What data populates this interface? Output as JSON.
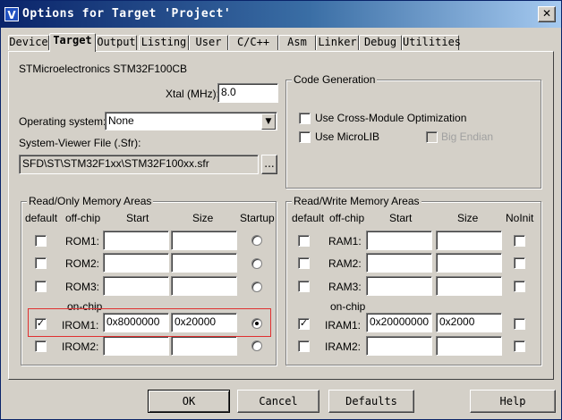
{
  "window": {
    "title": "Options for Target 'Project'",
    "close_glyph": "✕",
    "app_icon": "V"
  },
  "tabs": [
    "Device",
    "Target",
    "Output",
    "Listing",
    "User",
    "C/C++",
    "Asm",
    "Linker",
    "Debug",
    "Utilities"
  ],
  "active_tab": "Target",
  "device_name": "STMicroelectronics STM32F100CB",
  "xtal": {
    "label": "Xtal (MHz):",
    "value": "8.0"
  },
  "os": {
    "label": "Operating system:",
    "value": "None"
  },
  "sfr": {
    "label": "System-Viewer File (.Sfr):",
    "value": "SFD\\ST\\STM32F1xx\\STM32F100xx.sfr",
    "browse": "..."
  },
  "code_gen": {
    "title": "Code Generation",
    "cross_module": {
      "label": "Use Cross-Module Optimization",
      "checked": false
    },
    "microlib": {
      "label": "Use MicroLIB",
      "checked": false
    },
    "big_endian": {
      "label": "Big Endian",
      "checked": false,
      "disabled": true
    }
  },
  "rom": {
    "title": "Read/Only Memory Areas",
    "headers": {
      "default": "default",
      "offchip": "off-chip",
      "start": "Start",
      "size": "Size",
      "startup": "Startup"
    },
    "onchip_label": "on-chip",
    "rows": [
      {
        "label": "ROM1:",
        "start": "",
        "size": "",
        "default": false,
        "startup": false
      },
      {
        "label": "ROM2:",
        "start": "",
        "size": "",
        "default": false,
        "startup": false
      },
      {
        "label": "ROM3:",
        "start": "",
        "size": "",
        "default": false,
        "startup": false
      },
      {
        "label": "IROM1:",
        "start": "0x8000000",
        "size": "0x20000",
        "default": true,
        "startup": true
      },
      {
        "label": "IROM2:",
        "start": "",
        "size": "",
        "default": false,
        "startup": false
      }
    ]
  },
  "ram": {
    "title": "Read/Write Memory Areas",
    "headers": {
      "default": "default",
      "offchip": "off-chip",
      "start": "Start",
      "size": "Size",
      "noinit": "NoInit"
    },
    "onchip_label": "on-chip",
    "rows": [
      {
        "label": "RAM1:",
        "start": "",
        "size": "",
        "default": false,
        "noinit": false
      },
      {
        "label": "RAM2:",
        "start": "",
        "size": "",
        "default": false,
        "noinit": false
      },
      {
        "label": "RAM3:",
        "start": "",
        "size": "",
        "default": false,
        "noinit": false
      },
      {
        "label": "IRAM1:",
        "start": "0x20000000",
        "size": "0x2000",
        "default": true,
        "noinit": false
      },
      {
        "label": "IRAM2:",
        "start": "",
        "size": "",
        "default": false,
        "noinit": false
      }
    ]
  },
  "buttons": {
    "ok": "OK",
    "cancel": "Cancel",
    "defaults": "Defaults",
    "help": "Help"
  },
  "check_glyph": "✓"
}
